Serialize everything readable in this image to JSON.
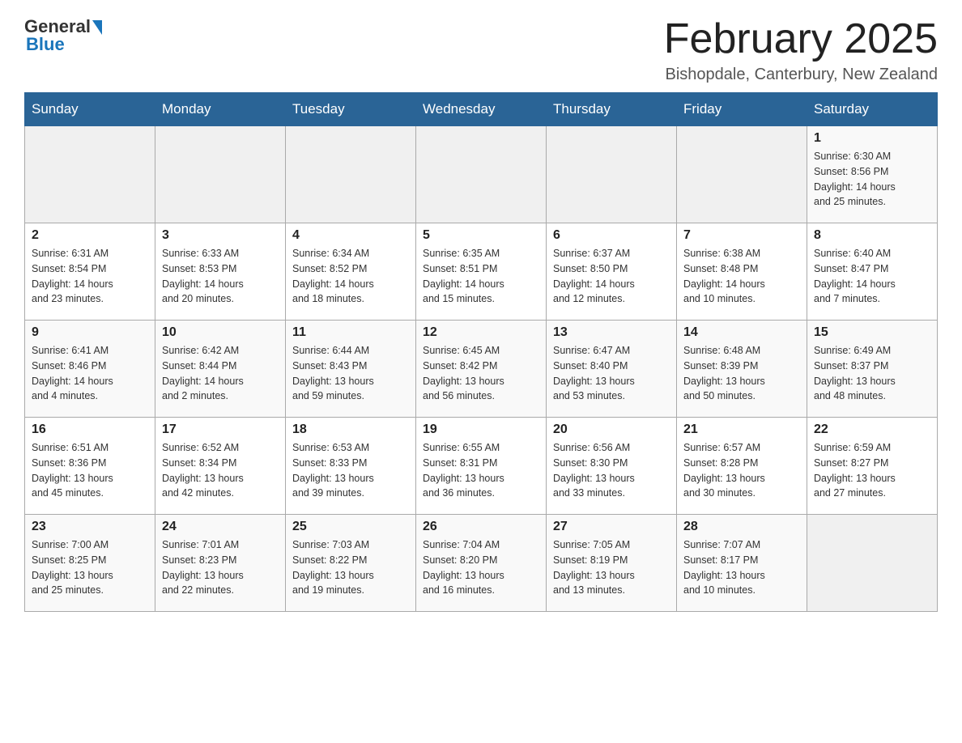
{
  "header": {
    "logo_general": "General",
    "logo_blue": "Blue",
    "month_year": "February 2025",
    "location": "Bishopdale, Canterbury, New Zealand"
  },
  "weekdays": [
    "Sunday",
    "Monday",
    "Tuesday",
    "Wednesday",
    "Thursday",
    "Friday",
    "Saturday"
  ],
  "weeks": [
    [
      {
        "day": "",
        "info": ""
      },
      {
        "day": "",
        "info": ""
      },
      {
        "day": "",
        "info": ""
      },
      {
        "day": "",
        "info": ""
      },
      {
        "day": "",
        "info": ""
      },
      {
        "day": "",
        "info": ""
      },
      {
        "day": "1",
        "info": "Sunrise: 6:30 AM\nSunset: 8:56 PM\nDaylight: 14 hours\nand 25 minutes."
      }
    ],
    [
      {
        "day": "2",
        "info": "Sunrise: 6:31 AM\nSunset: 8:54 PM\nDaylight: 14 hours\nand 23 minutes."
      },
      {
        "day": "3",
        "info": "Sunrise: 6:33 AM\nSunset: 8:53 PM\nDaylight: 14 hours\nand 20 minutes."
      },
      {
        "day": "4",
        "info": "Sunrise: 6:34 AM\nSunset: 8:52 PM\nDaylight: 14 hours\nand 18 minutes."
      },
      {
        "day": "5",
        "info": "Sunrise: 6:35 AM\nSunset: 8:51 PM\nDaylight: 14 hours\nand 15 minutes."
      },
      {
        "day": "6",
        "info": "Sunrise: 6:37 AM\nSunset: 8:50 PM\nDaylight: 14 hours\nand 12 minutes."
      },
      {
        "day": "7",
        "info": "Sunrise: 6:38 AM\nSunset: 8:48 PM\nDaylight: 14 hours\nand 10 minutes."
      },
      {
        "day": "8",
        "info": "Sunrise: 6:40 AM\nSunset: 8:47 PM\nDaylight: 14 hours\nand 7 minutes."
      }
    ],
    [
      {
        "day": "9",
        "info": "Sunrise: 6:41 AM\nSunset: 8:46 PM\nDaylight: 14 hours\nand 4 minutes."
      },
      {
        "day": "10",
        "info": "Sunrise: 6:42 AM\nSunset: 8:44 PM\nDaylight: 14 hours\nand 2 minutes."
      },
      {
        "day": "11",
        "info": "Sunrise: 6:44 AM\nSunset: 8:43 PM\nDaylight: 13 hours\nand 59 minutes."
      },
      {
        "day": "12",
        "info": "Sunrise: 6:45 AM\nSunset: 8:42 PM\nDaylight: 13 hours\nand 56 minutes."
      },
      {
        "day": "13",
        "info": "Sunrise: 6:47 AM\nSunset: 8:40 PM\nDaylight: 13 hours\nand 53 minutes."
      },
      {
        "day": "14",
        "info": "Sunrise: 6:48 AM\nSunset: 8:39 PM\nDaylight: 13 hours\nand 50 minutes."
      },
      {
        "day": "15",
        "info": "Sunrise: 6:49 AM\nSunset: 8:37 PM\nDaylight: 13 hours\nand 48 minutes."
      }
    ],
    [
      {
        "day": "16",
        "info": "Sunrise: 6:51 AM\nSunset: 8:36 PM\nDaylight: 13 hours\nand 45 minutes."
      },
      {
        "day": "17",
        "info": "Sunrise: 6:52 AM\nSunset: 8:34 PM\nDaylight: 13 hours\nand 42 minutes."
      },
      {
        "day": "18",
        "info": "Sunrise: 6:53 AM\nSunset: 8:33 PM\nDaylight: 13 hours\nand 39 minutes."
      },
      {
        "day": "19",
        "info": "Sunrise: 6:55 AM\nSunset: 8:31 PM\nDaylight: 13 hours\nand 36 minutes."
      },
      {
        "day": "20",
        "info": "Sunrise: 6:56 AM\nSunset: 8:30 PM\nDaylight: 13 hours\nand 33 minutes."
      },
      {
        "day": "21",
        "info": "Sunrise: 6:57 AM\nSunset: 8:28 PM\nDaylight: 13 hours\nand 30 minutes."
      },
      {
        "day": "22",
        "info": "Sunrise: 6:59 AM\nSunset: 8:27 PM\nDaylight: 13 hours\nand 27 minutes."
      }
    ],
    [
      {
        "day": "23",
        "info": "Sunrise: 7:00 AM\nSunset: 8:25 PM\nDaylight: 13 hours\nand 25 minutes."
      },
      {
        "day": "24",
        "info": "Sunrise: 7:01 AM\nSunset: 8:23 PM\nDaylight: 13 hours\nand 22 minutes."
      },
      {
        "day": "25",
        "info": "Sunrise: 7:03 AM\nSunset: 8:22 PM\nDaylight: 13 hours\nand 19 minutes."
      },
      {
        "day": "26",
        "info": "Sunrise: 7:04 AM\nSunset: 8:20 PM\nDaylight: 13 hours\nand 16 minutes."
      },
      {
        "day": "27",
        "info": "Sunrise: 7:05 AM\nSunset: 8:19 PM\nDaylight: 13 hours\nand 13 minutes."
      },
      {
        "day": "28",
        "info": "Sunrise: 7:07 AM\nSunset: 8:17 PM\nDaylight: 13 hours\nand 10 minutes."
      },
      {
        "day": "",
        "info": ""
      }
    ]
  ]
}
